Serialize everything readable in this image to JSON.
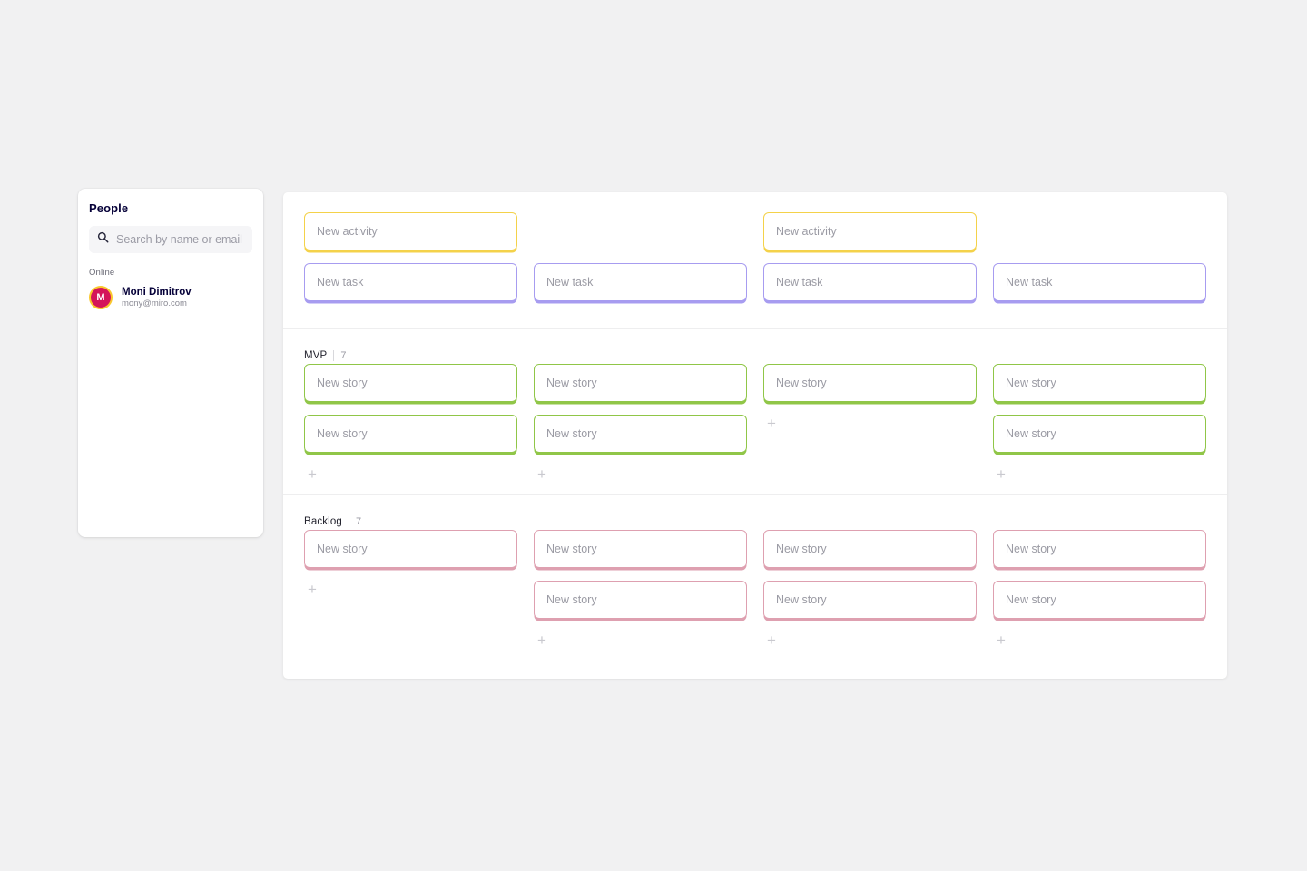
{
  "sidebar": {
    "title": "People",
    "search": {
      "icon": "search-icon",
      "placeholder": "Search by name or email",
      "value": ""
    },
    "group_label": "Online",
    "person": {
      "initial": "M",
      "name": "Moni Dimitrov",
      "email": "mony@miro.com",
      "avatar_bg": "#d4145a",
      "avatar_ring": "#f9c82e"
    }
  },
  "board": {
    "add_label": "+",
    "colors": {
      "activity": "#f4d24a",
      "task": "#a79cf0",
      "story_mvp": "#90c648",
      "story_backlog": "#dea0b0"
    },
    "sections": [
      {
        "id": "top",
        "name": "",
        "count": "",
        "has_header": false,
        "columns": [
          {
            "cards": [
              {
                "label": "New activity",
                "color": "yellow"
              },
              {
                "label": "New task",
                "color": "purple"
              }
            ],
            "add": false,
            "offset": 0
          },
          {
            "cards": [
              {
                "label": "New task",
                "color": "purple"
              }
            ],
            "add": false,
            "offset": 1
          },
          {
            "cards": [
              {
                "label": "New activity",
                "color": "yellow"
              },
              {
                "label": "New task",
                "color": "purple"
              }
            ],
            "add": false,
            "offset": 0
          },
          {
            "cards": [
              {
                "label": "New task",
                "color": "purple"
              }
            ],
            "add": false,
            "offset": 1
          }
        ]
      },
      {
        "id": "mvp",
        "name": "MVP",
        "count": "7",
        "has_header": true,
        "columns": [
          {
            "cards": [
              {
                "label": "New story",
                "color": "green"
              },
              {
                "label": "New story",
                "color": "green"
              }
            ],
            "add": true,
            "offset": 0
          },
          {
            "cards": [
              {
                "label": "New story",
                "color": "green"
              },
              {
                "label": "New story",
                "color": "green"
              }
            ],
            "add": true,
            "offset": 0
          },
          {
            "cards": [
              {
                "label": "New story",
                "color": "green"
              }
            ],
            "add": true,
            "offset": 0
          },
          {
            "cards": [
              {
                "label": "New story",
                "color": "green"
              },
              {
                "label": "New story",
                "color": "green"
              }
            ],
            "add": true,
            "offset": 0
          }
        ]
      },
      {
        "id": "backlog",
        "name": "Backlog",
        "count": "7",
        "has_header": true,
        "columns": [
          {
            "cards": [
              {
                "label": "New story",
                "color": "pink"
              }
            ],
            "add": true,
            "offset": 0
          },
          {
            "cards": [
              {
                "label": "New story",
                "color": "pink"
              },
              {
                "label": "New story",
                "color": "pink"
              }
            ],
            "add": true,
            "offset": 0
          },
          {
            "cards": [
              {
                "label": "New story",
                "color": "pink"
              },
              {
                "label": "New story",
                "color": "pink"
              }
            ],
            "add": true,
            "offset": 0
          },
          {
            "cards": [
              {
                "label": "New story",
                "color": "pink"
              },
              {
                "label": "New story",
                "color": "pink"
              }
            ],
            "add": true,
            "offset": 0
          }
        ]
      }
    ]
  }
}
